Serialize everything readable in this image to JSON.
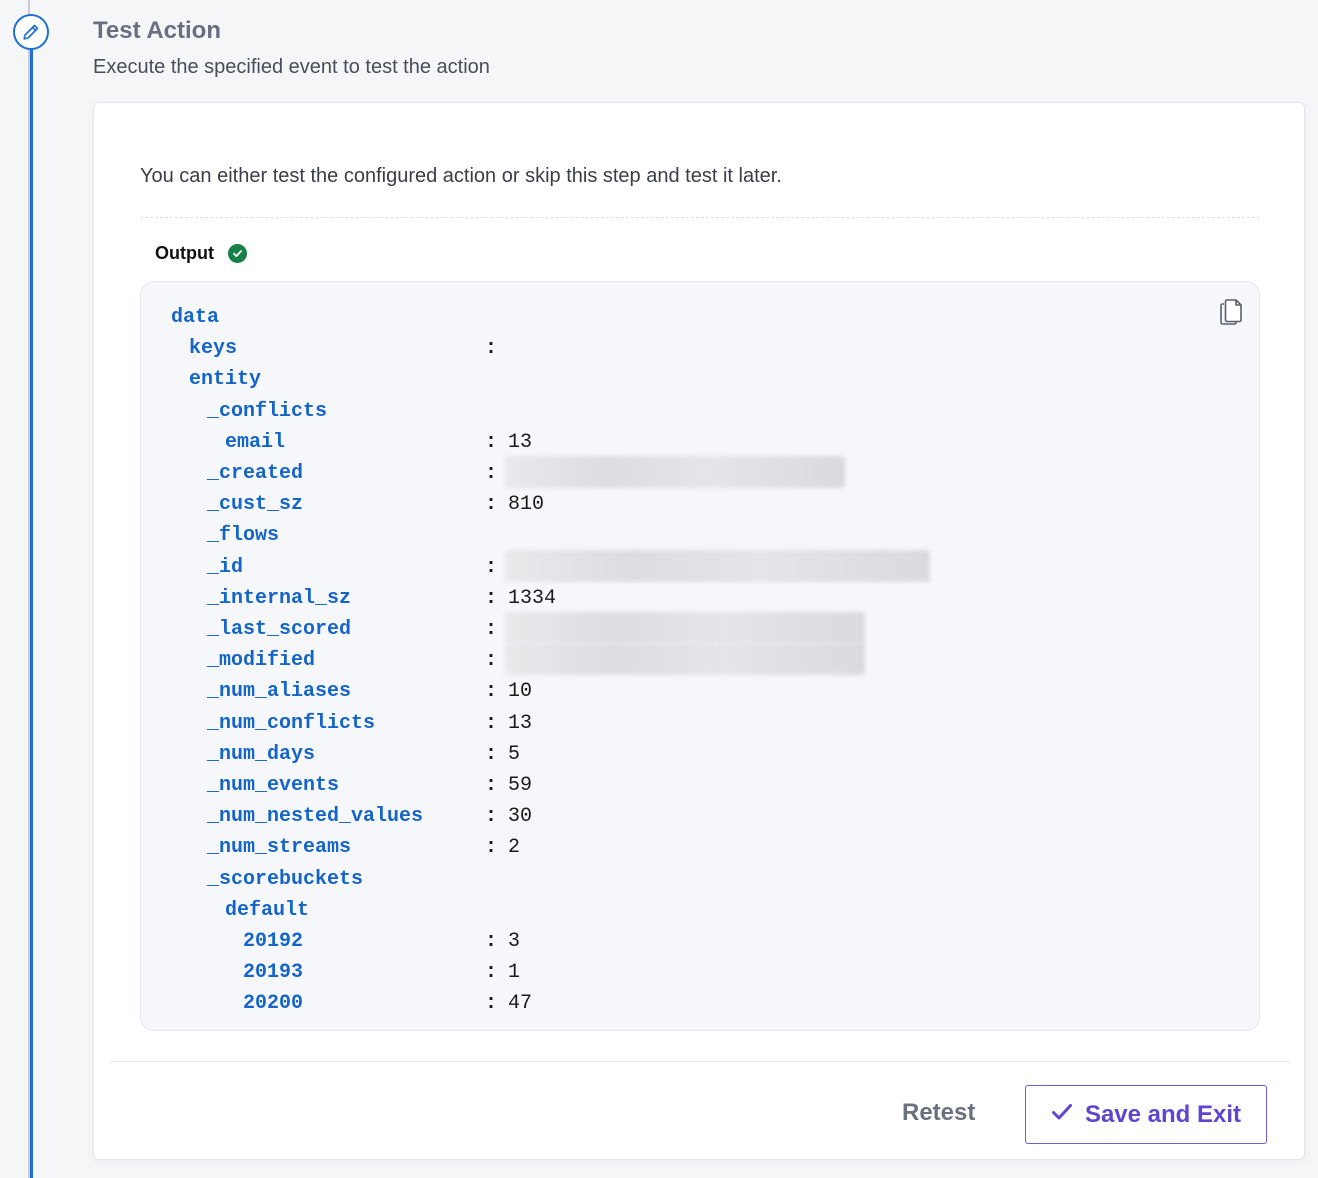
{
  "step": {
    "title": "Test Action",
    "subtitle": "Execute the specified event to test the action"
  },
  "card": {
    "info": "You can either test the configured action or skip this step and test it later.",
    "output_label": "Output",
    "output_status": "success"
  },
  "output": {
    "lines": [
      {
        "key": "data",
        "level": 0
      },
      {
        "key": "keys",
        "level": 1,
        "colon": ":"
      },
      {
        "key": "entity",
        "level": 1
      },
      {
        "key": "_conflicts",
        "level": 2
      },
      {
        "key": "email",
        "level": 3,
        "colon": ":",
        "value": "13"
      },
      {
        "key": "_created",
        "level": 2,
        "colon": ":",
        "redacted": true
      },
      {
        "key": "_cust_sz",
        "level": 2,
        "colon": ":",
        "value": "810"
      },
      {
        "key": "_flows",
        "level": 2
      },
      {
        "key": "_id",
        "level": 2,
        "colon": ":",
        "redacted": true
      },
      {
        "key": "_internal_sz",
        "level": 2,
        "colon": ":",
        "value": "1334"
      },
      {
        "key": "_last_scored",
        "level": 2,
        "colon": ":",
        "redacted": true
      },
      {
        "key": "_modified",
        "level": 2,
        "colon": ":",
        "redacted": true
      },
      {
        "key": "_num_aliases",
        "level": 2,
        "colon": ":",
        "value": "10"
      },
      {
        "key": "_num_conflicts",
        "level": 2,
        "colon": ":",
        "value": "13"
      },
      {
        "key": "_num_days",
        "level": 2,
        "colon": ":",
        "value": "5"
      },
      {
        "key": "_num_events",
        "level": 2,
        "colon": ":",
        "value": "59"
      },
      {
        "key": "_num_nested_values",
        "level": 2,
        "colon": ":",
        "value": "30"
      },
      {
        "key": "_num_streams",
        "level": 2,
        "colon": ":",
        "value": "2"
      },
      {
        "key": "_scorebuckets",
        "level": 2
      },
      {
        "key": "default",
        "level": 3
      },
      {
        "key": "20192",
        "level": 4,
        "colon": ":",
        "value": "3"
      },
      {
        "key": "20193",
        "level": 4,
        "colon": ":",
        "value": "1"
      },
      {
        "key": "20200",
        "level": 4,
        "colon": ":",
        "value": "47"
      }
    ]
  },
  "actions": {
    "retest_label": "Retest",
    "save_label": "Save and Exit"
  },
  "colors": {
    "accent": "#1f6fd0",
    "key_color": "#1565c9",
    "success": "#17814a",
    "primary_button": "#6045d1"
  }
}
